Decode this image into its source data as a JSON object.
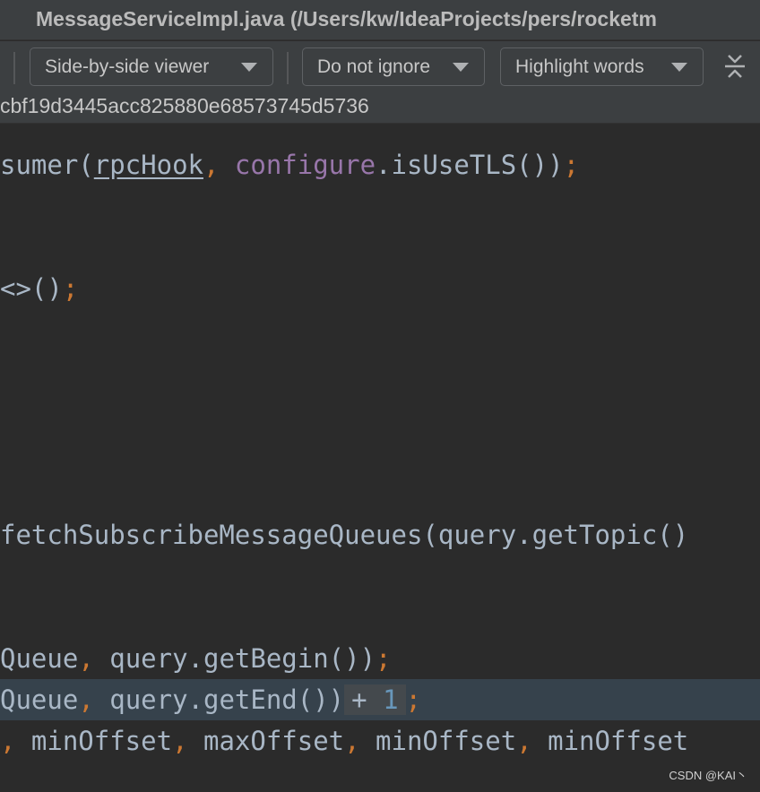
{
  "window": {
    "title": "MessageServiceImpl.java (/Users/kw/IdeaProjects/pers/rocketm"
  },
  "toolbar": {
    "viewer_mode": "Side-by-side viewer",
    "whitespace_mode": "Do not ignore",
    "highlight_mode": "Highlight words"
  },
  "revision": {
    "hash": "cbf19d3445acc825880e68573745d5736"
  },
  "code": {
    "line1": {
      "t1": "sumer(",
      "t2": "rpcHook",
      "t3": ", ",
      "t4": "configure",
      "t5": ".isUseTLS())",
      "t6": ";"
    },
    "line2": {
      "t1": "<>()",
      "t2": ";"
    },
    "line3": {
      "t1": "fetchSubscribeMessageQueues(query.getTopic()"
    },
    "line4": {
      "t1": "Queue",
      "t2": ", ",
      "t3": "query.getBegin())",
      "t4": ";"
    },
    "line5": {
      "t1": "Queue",
      "t2": ", ",
      "t3": "query.getEnd())",
      "t4": "+ ",
      "t5": "1",
      "t6": ";"
    },
    "line6": {
      "t1": ", ",
      "t2": "minOffset",
      "t3": ", ",
      "t4": "maxOffset",
      "t5": ", ",
      "t6": "minOffset",
      "t7": ", ",
      "t8": "minOffset"
    }
  },
  "colors": {
    "background": "#2b2b2b",
    "panel": "#3c3f41",
    "keyword_punctuation": "#cc7832",
    "field": "#9876aa",
    "number": "#6897bb",
    "text": "#a9b7c6",
    "changed_line": "#36424c"
  },
  "icons": {
    "dropdown": "chevron-down-icon",
    "collapse": "collapse-unchanged-icon"
  },
  "watermark": "CSDN @KAI丶"
}
